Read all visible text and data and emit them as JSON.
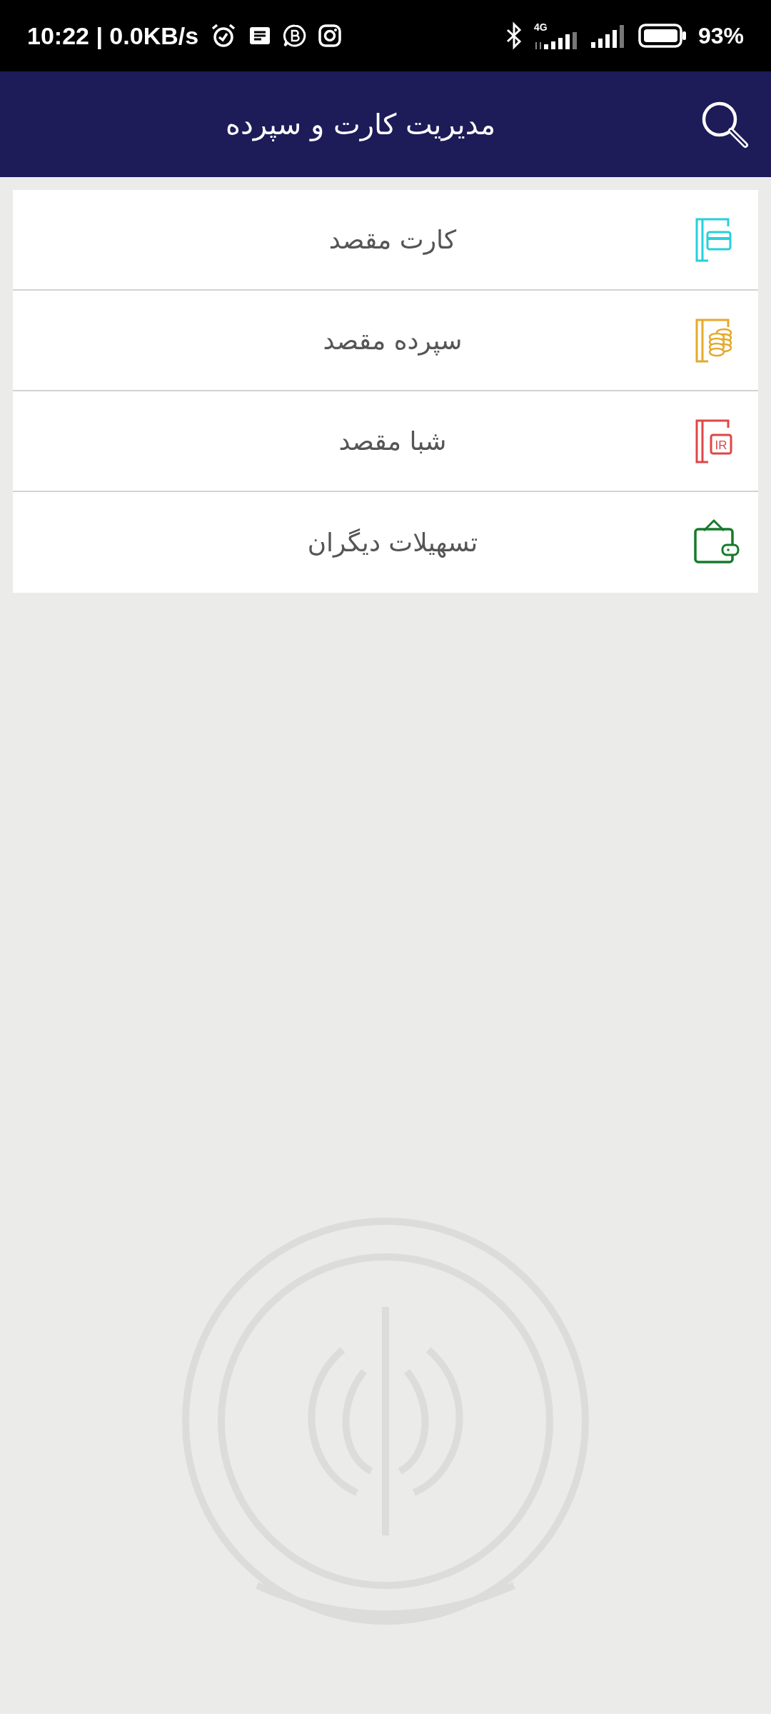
{
  "status_bar": {
    "time": "10:22 | 0.0KB/s",
    "network_type": "4G",
    "battery": "93%"
  },
  "header": {
    "title": "مدیریت کارت و سپرده"
  },
  "items": [
    {
      "kind": "card",
      "label": "کارت مقصد",
      "color": "#25d0dc"
    },
    {
      "kind": "coins",
      "label": "سپرده مقصد",
      "color": "#e5a92b"
    },
    {
      "kind": "iban",
      "label": "شبا مقصد",
      "color": "#e04646",
      "icon_text": "IR"
    },
    {
      "kind": "wallet",
      "label": "تسهیلات دیگران",
      "color": "#177a2c"
    }
  ]
}
